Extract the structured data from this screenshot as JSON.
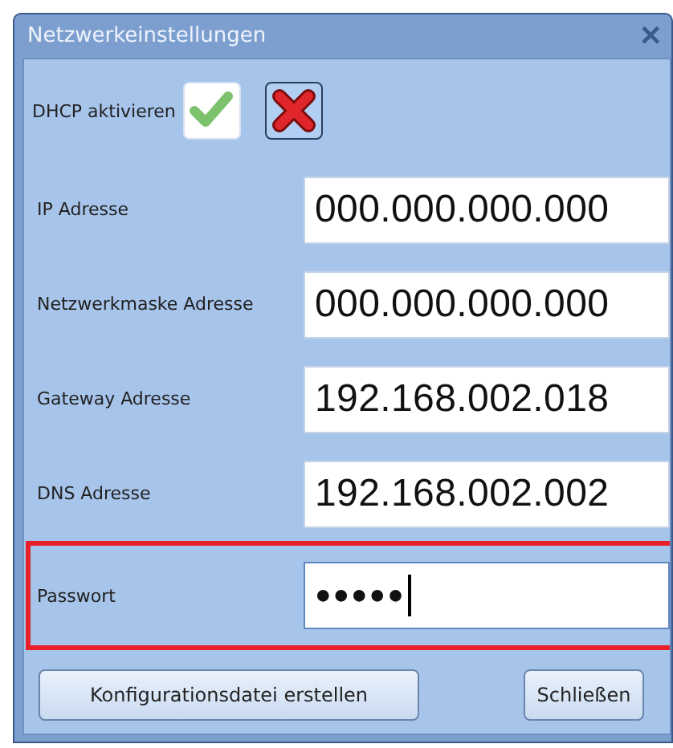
{
  "window": {
    "title": "Netzwerkeinstellungen",
    "close_glyph": "✕"
  },
  "dhcp": {
    "label": "DHCP aktivieren",
    "options": [
      {
        "kind": "enable",
        "selected": false
      },
      {
        "kind": "disable",
        "selected": true
      }
    ]
  },
  "fields": [
    {
      "label": "IP Adresse",
      "value": "000.000.000.000",
      "highlighted": false,
      "focused": false
    },
    {
      "label": "Netzwerkmaske Adresse",
      "value": "000.000.000.000",
      "highlighted": false,
      "focused": false
    },
    {
      "label": "Gateway Adresse",
      "value": "192.168.002.018",
      "highlighted": false,
      "focused": false
    },
    {
      "label": "DNS Adresse",
      "value": "192.168.002.002",
      "highlighted": false,
      "focused": false
    },
    {
      "label": "Passwort",
      "value": "●●●●●",
      "highlighted": true,
      "focused": true
    }
  ],
  "buttons": [
    {
      "label": "Konfigurationsdatei erstellen"
    },
    {
      "label": "Schließen"
    }
  ]
}
